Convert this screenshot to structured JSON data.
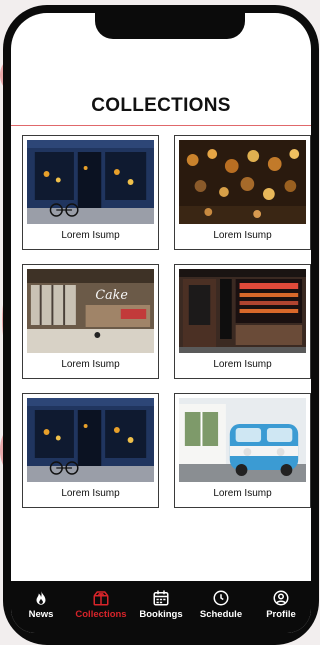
{
  "screen": {
    "title": "COLLECTIONS"
  },
  "collections": [
    {
      "label": "Lorem Isump",
      "image": "blue-storefront-with-bicycle"
    },
    {
      "label": "Lorem Isump",
      "image": "hanging-lanterns-shop"
    },
    {
      "label": "Lorem Isump",
      "image": "cafe-interior-neon-sign"
    },
    {
      "label": "Lorem Isump",
      "image": "night-shopfront"
    },
    {
      "label": "Lorem Isump",
      "image": "blue-storefront-with-bicycle"
    },
    {
      "label": "Lorem Isump",
      "image": "blue-vw-van"
    }
  ],
  "tabbar": {
    "tabs": [
      {
        "label": "News",
        "icon": "flame-icon"
      },
      {
        "label": "Collections",
        "icon": "box-icon",
        "active": true
      },
      {
        "label": "Bookings",
        "icon": "calendar-icon"
      },
      {
        "label": "Schedule",
        "icon": "clock-icon"
      },
      {
        "label": "Profile",
        "icon": "user-circle-icon"
      }
    ]
  },
  "colors": {
    "accent": "#d7242a",
    "tabbar_bg": "#0b0b0b"
  }
}
